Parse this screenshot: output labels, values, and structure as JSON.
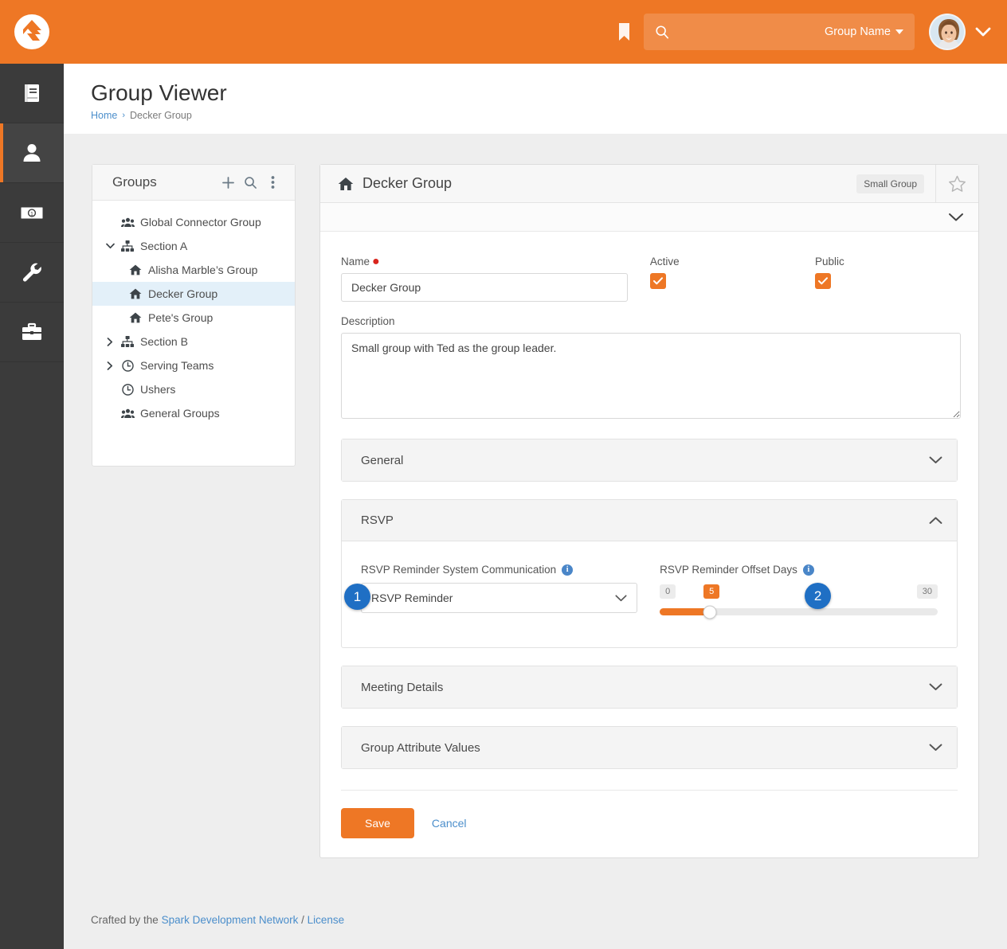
{
  "brand": {
    "accent": "#ee7725",
    "link": "#4b8ecb",
    "callout": "#1f6fc4",
    "rail_bg": "#3b3b3b"
  },
  "topbar": {
    "logo_name": "rock-logo",
    "bookmark_label": "bookmark-icon",
    "search": {
      "value": "",
      "placeholder": ""
    },
    "group_selector": "Group Name",
    "avatar_alt": "user-avatar"
  },
  "rail": {
    "items": [
      {
        "name": "book-icon",
        "active": false
      },
      {
        "name": "person-icon",
        "active": true
      },
      {
        "name": "money-icon",
        "active": false
      },
      {
        "name": "wrench-icon",
        "active": false
      },
      {
        "name": "briefcase-icon",
        "active": false
      }
    ]
  },
  "page": {
    "title": "Group Viewer",
    "breadcrumb": {
      "home": "Home",
      "separator": "›",
      "current": "Decker Group"
    }
  },
  "groups_panel": {
    "title": "Groups",
    "actions": [
      "plus-icon",
      "search-icon",
      "ellipsis-vertical-icon"
    ],
    "tree": [
      {
        "label": "Global Connector Group",
        "icon": "users-icon",
        "arrow": "none",
        "indent": 1,
        "selected": false
      },
      {
        "label": "Section A",
        "icon": "sitemap-icon",
        "arrow": "down",
        "indent": 1,
        "selected": false
      },
      {
        "label": "Alisha Marble’s Group",
        "icon": "home-icon",
        "arrow": "none",
        "indent": 2,
        "selected": false
      },
      {
        "label": "Decker Group",
        "icon": "home-icon",
        "arrow": "none",
        "indent": 2,
        "selected": true
      },
      {
        "label": "Pete's Group",
        "icon": "home-icon",
        "arrow": "none",
        "indent": 2,
        "selected": false
      },
      {
        "label": "Section B",
        "icon": "sitemap-icon",
        "arrow": "right",
        "indent": 1,
        "selected": false
      },
      {
        "label": "Serving Teams",
        "icon": "clock-icon",
        "arrow": "right",
        "indent": 1,
        "selected": false
      },
      {
        "label": "Ushers",
        "icon": "clock-icon",
        "arrow": "none",
        "indent": 1,
        "selected": false
      },
      {
        "label": "General Groups",
        "icon": "users-icon",
        "arrow": "none",
        "indent": 1,
        "selected": false
      }
    ]
  },
  "detail": {
    "header": {
      "title": "Decker Group",
      "badge": "Small Group",
      "icon": "home-icon",
      "star": "star-outline-icon"
    },
    "name_field": {
      "label": "Name",
      "required": true,
      "value": "Decker Group"
    },
    "active_field": {
      "label": "Active",
      "checked": true
    },
    "public_field": {
      "label": "Public",
      "checked": true
    },
    "description": {
      "label": "Description",
      "value": "Small group with Ted as the group leader.",
      "placeholder": ""
    },
    "sections": [
      {
        "key": "general",
        "title": "General",
        "expanded": false
      },
      {
        "key": "rsvp",
        "title": "RSVP",
        "expanded": true
      },
      {
        "key": "meeting",
        "title": "Meeting Details",
        "expanded": false
      },
      {
        "key": "attributes",
        "title": "Group Attribute Values",
        "expanded": false
      }
    ],
    "rsvp": {
      "communication": {
        "label": "RSVP Reminder System Communication",
        "info": "info-icon",
        "selected": "RSVP Reminder",
        "options": [
          "RSVP Reminder"
        ]
      },
      "offset_days": {
        "label": "RSVP Reminder Offset Days",
        "info": "info-icon",
        "min": "0",
        "max": "30",
        "value": "5",
        "percent": 18
      }
    },
    "actions": {
      "save": "Save",
      "cancel": "Cancel"
    }
  },
  "callouts": [
    {
      "number": "1",
      "target": "rsvp-communication-select"
    },
    {
      "number": "2",
      "target": "rsvp-offset-days-slider"
    }
  ],
  "footer": {
    "prefix": "Crafted by the ",
    "org": "Spark Development Network",
    "divider": " / ",
    "license": "License"
  }
}
